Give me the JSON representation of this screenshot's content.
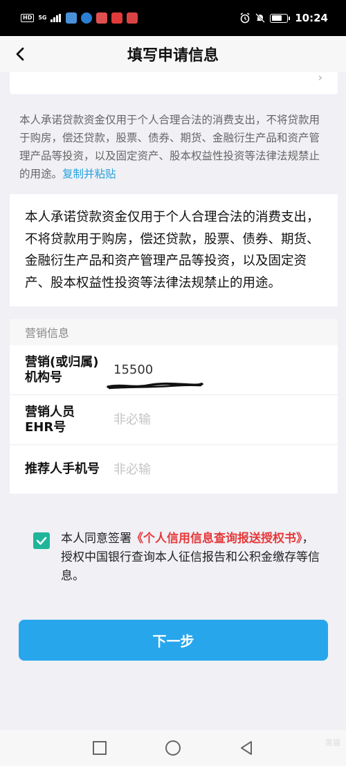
{
  "status_bar": {
    "hd_badge": "HD",
    "network": "5G",
    "time": "10:24",
    "app_colors": [
      "#4a90d9",
      "#2a7fd4",
      "#e04f4f",
      "#e03a3a",
      "#d94343"
    ]
  },
  "header": {
    "title": "填写申请信息"
  },
  "instruction": {
    "text": "本人承诺贷款资金仅用于个人合理合法的消费支出，不将贷款用于购房，偿还贷款，股票、债券、期货、金融衍生产品和资产管理产品等投资，以及固定资产、股本权益性投资等法律法规禁止的用途。",
    "copy_link": "复制并粘贴"
  },
  "commitment_box": {
    "text": "本人承诺贷款资金仅用于个人合理合法的消费支出，不将贷款用于购房，偿还贷款，股票、债券、期货、金融衍生产品和资产管理产品等投资，以及固定资产、股本权益性投资等法律法规禁止的用途。"
  },
  "marketing": {
    "section_title": "营销信息",
    "org_label_line1": "营销(或归属)",
    "org_label_line2": "机构号",
    "org_value": "15500",
    "ehr_label_line1": "营销人员",
    "ehr_label_line2": "EHR号",
    "ehr_placeholder": "非必输",
    "referrer_label": "推荐人手机号",
    "referrer_placeholder": "非必输"
  },
  "agreement": {
    "prefix": "本人同意签署",
    "link": "《个人信用信息查询报送授权书》",
    "suffix": "，授权中国银行查询本人征信报告和公积金缴存等信息。",
    "checked_color": "#1fb59a"
  },
  "next_button": {
    "label": "下一步",
    "color": "#27a6ec"
  },
  "watermark": "黑猫"
}
